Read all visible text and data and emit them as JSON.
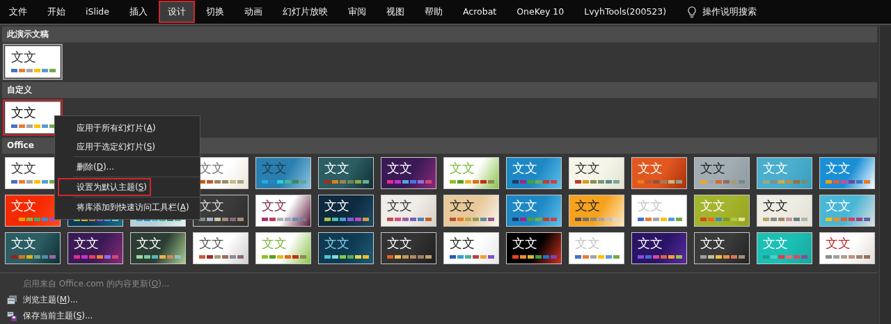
{
  "menu_bar": {
    "tabs": [
      {
        "label": "文件",
        "selected": false,
        "highlighted": false
      },
      {
        "label": "开始",
        "selected": false,
        "highlighted": false
      },
      {
        "label": "iSlide",
        "selected": false,
        "highlighted": false
      },
      {
        "label": "插入",
        "selected": false,
        "highlighted": false
      },
      {
        "label": "设计",
        "selected": true,
        "highlighted": true
      },
      {
        "label": "切换",
        "selected": false,
        "highlighted": false
      },
      {
        "label": "动画",
        "selected": false,
        "highlighted": false
      },
      {
        "label": "幻灯片放映",
        "selected": false,
        "highlighted": false
      },
      {
        "label": "审阅",
        "selected": false,
        "highlighted": false
      },
      {
        "label": "视图",
        "selected": false,
        "highlighted": false
      },
      {
        "label": "帮助",
        "selected": false,
        "highlighted": false
      },
      {
        "label": "Acrobat",
        "selected": false,
        "highlighted": false
      },
      {
        "label": "OneKey 10",
        "selected": false,
        "highlighted": false
      },
      {
        "label": "LvyhTools(200523)",
        "selected": false,
        "highlighted": false
      }
    ],
    "tell_me": {
      "label": "操作说明搜索"
    }
  },
  "gallery": {
    "sections": [
      {
        "title": "此演示文稿",
        "rows": [
          [
            {
              "kind": "theme",
              "text": "文文",
              "selected": true,
              "highlighted": false,
              "color": "#ffffff"
            }
          ]
        ]
      },
      {
        "title": "自定义",
        "rows": [
          [
            {
              "kind": "theme",
              "text": "文文",
              "selected": false,
              "highlighted": true,
              "color": "#ffffff"
            }
          ]
        ]
      },
      {
        "title": "Office",
        "rows": [
          [
            {
              "kind": "theme",
              "text": "文文",
              "selected": false,
              "highlighted": false,
              "color": "#ffffff"
            },
            {
              "kind": "slot"
            },
            {
              "kind": "slot"
            },
            {
              "kind": "theme",
              "text": "文文",
              "selected": false,
              "highlighted": false,
              "color": "#ffffff"
            },
            {
              "kind": "theme",
              "text": "文文",
              "selected": false,
              "highlighted": false,
              "color": "#2a7fb0"
            },
            {
              "kind": "theme",
              "text": "文文",
              "selected": false,
              "highlighted": false,
              "color": "#2b5d63"
            },
            {
              "kind": "theme",
              "text": "文文",
              "selected": false,
              "highlighted": false,
              "color": "#3a1a55"
            },
            {
              "kind": "theme",
              "text": "文文",
              "selected": false,
              "highlighted": false,
              "color": "#ffffff"
            },
            {
              "kind": "theme",
              "text": "文文",
              "selected": false,
              "highlighted": false,
              "color": "#1e88c4"
            },
            {
              "kind": "theme",
              "text": "文文",
              "selected": false,
              "highlighted": false,
              "color": "#f5f5ea"
            },
            {
              "kind": "theme",
              "text": "文文",
              "selected": false,
              "highlighted": false,
              "color": "#e2571f"
            },
            {
              "kind": "theme",
              "text": "文文",
              "selected": false,
              "highlighted": false,
              "color": "#a2adb3"
            },
            {
              "kind": "theme",
              "text": "文文",
              "selected": false,
              "highlighted": false,
              "color": "#4aaecc"
            },
            {
              "kind": "theme",
              "text": "文文",
              "selected": false,
              "highlighted": false,
              "color": "#1a8fd6"
            }
          ],
          [
            {
              "kind": "theme",
              "text": "文文",
              "selected": false,
              "highlighted": false,
              "color": "#f62a00"
            },
            {
              "kind": "theme",
              "selected": false,
              "highlighted": false,
              "color": "#0b3a5a"
            },
            {
              "kind": "theme",
              "selected": false,
              "highlighted": false,
              "color": "#b8cfd6"
            },
            {
              "kind": "theme",
              "text": "文文",
              "selected": false,
              "highlighted": false,
              "color": "#3b3b3b"
            },
            {
              "kind": "theme",
              "text": "文文",
              "selected": false,
              "highlighted": false,
              "color": "#ffffff"
            },
            {
              "kind": "theme",
              "text": "文文",
              "selected": false,
              "highlighted": false,
              "color": "#0d2a3e"
            },
            {
              "kind": "theme",
              "text": "文文",
              "selected": false,
              "highlighted": false,
              "color": "#f0ece8"
            },
            {
              "kind": "theme",
              "text": "文文",
              "selected": false,
              "highlighted": false,
              "color": "#e8c99a"
            },
            {
              "kind": "theme",
              "text": "文文",
              "selected": false,
              "highlighted": false,
              "color": "#1e88c4"
            },
            {
              "kind": "theme",
              "text": "文文",
              "selected": false,
              "highlighted": false,
              "color": "#f6a21d"
            },
            {
              "kind": "theme",
              "text": "文文",
              "selected": false,
              "highlighted": false,
              "color": "#ffffff"
            },
            {
              "kind": "theme",
              "text": "文文",
              "selected": false,
              "highlighted": false,
              "color": "#a4b42c"
            },
            {
              "kind": "theme",
              "text": "文文",
              "selected": false,
              "highlighted": false,
              "color": "#efece4"
            },
            {
              "kind": "theme",
              "text": "文文",
              "selected": false,
              "highlighted": false,
              "color": "#4ab6d6"
            }
          ],
          [
            {
              "kind": "theme",
              "text": "文文",
              "selected": false,
              "highlighted": false,
              "color": "#2b5d63"
            },
            {
              "kind": "theme",
              "text": "文文",
              "selected": false,
              "highlighted": false,
              "color": "#3a1a55"
            },
            {
              "kind": "theme",
              "text": "文文",
              "selected": false,
              "highlighted": false,
              "color": "#2c3e34"
            },
            {
              "kind": "theme",
              "text": "文文",
              "selected": false,
              "highlighted": false,
              "color": "#ffffff"
            },
            {
              "kind": "theme",
              "text": "文文",
              "selected": false,
              "highlighted": false,
              "color": "#ffffff"
            },
            {
              "kind": "theme",
              "text": "文文",
              "selected": false,
              "highlighted": false,
              "color": "#103a52"
            },
            {
              "kind": "theme",
              "text": "文文",
              "selected": false,
              "highlighted": false,
              "color": "#333333"
            },
            {
              "kind": "theme",
              "text": "文文",
              "selected": false,
              "highlighted": false,
              "color": "#ffffff"
            },
            {
              "kind": "theme",
              "text": "文文",
              "selected": false,
              "highlighted": false,
              "color": "#000000"
            },
            {
              "kind": "theme",
              "text": "文文",
              "selected": false,
              "highlighted": false,
              "color": "#ffffff"
            },
            {
              "kind": "theme",
              "text": "文文",
              "selected": false,
              "highlighted": false,
              "color": "#2a1466"
            },
            {
              "kind": "theme",
              "text": "文文",
              "selected": false,
              "highlighted": false,
              "color": "#3a3a3a"
            },
            {
              "kind": "theme",
              "text": "文文",
              "selected": false,
              "highlighted": false,
              "color": "#1bbfb4"
            },
            {
              "kind": "theme",
              "text": "文文",
              "selected": false,
              "highlighted": false,
              "color": "#ffffff"
            }
          ]
        ]
      }
    ],
    "commands": [
      {
        "kind": "none",
        "label": "启用来自 Office.com 的内容更新(",
        "key": "O",
        "suffix": ")...",
        "disabled": true
      },
      {
        "kind": "browse",
        "label": "浏览主题(",
        "key": "M",
        "suffix": ")...",
        "disabled": false
      },
      {
        "kind": "save",
        "label": "保存当前主题(",
        "key": "S",
        "suffix": ")...",
        "disabled": false
      }
    ]
  },
  "context_menu": {
    "items": [
      {
        "label": "应用于所有幻灯片(",
        "key": "A",
        "suffix": ")",
        "separator_before": false,
        "highlighted": false
      },
      {
        "label": "应用于选定幻灯片(",
        "key": "S",
        "suffix": ")",
        "separator_before": false,
        "highlighted": false
      },
      {
        "label": "删除(",
        "key": "D",
        "suffix": ")...",
        "separator_before": true,
        "highlighted": false
      },
      {
        "label": "设置为默认主题(",
        "key": "S",
        "suffix": ")",
        "separator_before": true,
        "highlighted": true
      },
      {
        "label": "将库添加到快速访问工具栏(",
        "key": "A",
        "suffix": ")",
        "separator_before": true,
        "highlighted": false
      }
    ]
  }
}
